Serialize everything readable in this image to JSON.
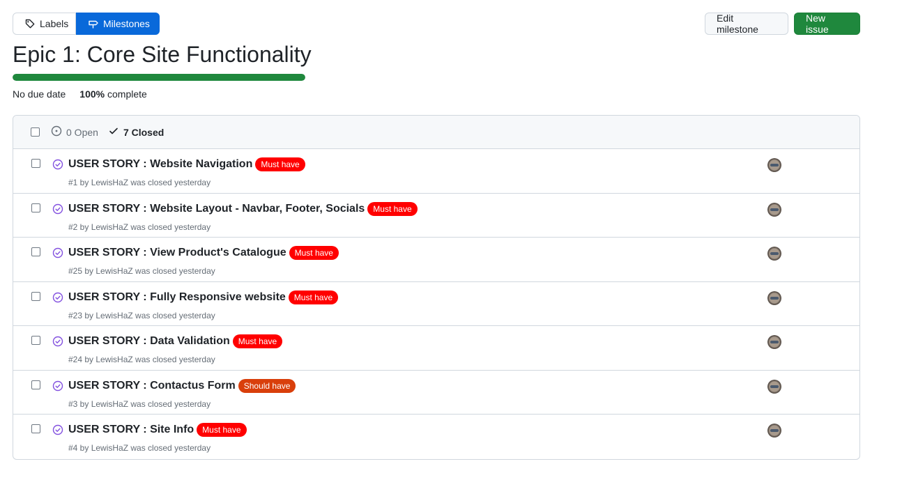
{
  "nav": {
    "labels_label": "Labels",
    "milestones_label": "Milestones"
  },
  "actions": {
    "edit_label": "Edit milestone",
    "new_label": "New issue"
  },
  "milestone": {
    "title": "Epic 1: Core Site Functionality",
    "due": "No due date",
    "percent": "100%",
    "complete_word": "complete",
    "progress_fraction": 1.0
  },
  "list": {
    "open_label": "0 Open",
    "closed_label": "7 Closed"
  },
  "colors": {
    "must_have": "#ff0000",
    "should_have": "#d93f0b",
    "closed_icon": "#8250df",
    "progress": "#1f883d"
  },
  "issues": [
    {
      "title": "USER STORY : Website Navigation",
      "label": "Must have",
      "label_color": "#ff0000",
      "meta": "#1 by LewisHaZ was closed yesterday"
    },
    {
      "title": "USER STORY : Website Layout - Navbar, Footer, Socials",
      "label": "Must have",
      "label_color": "#ff0000",
      "meta": "#2 by LewisHaZ was closed yesterday"
    },
    {
      "title": "USER STORY : View Product's Catalogue",
      "label": "Must have",
      "label_color": "#ff0000",
      "meta": "#25 by LewisHaZ was closed yesterday"
    },
    {
      "title": "USER STORY : Fully Responsive website",
      "label": "Must have",
      "label_color": "#ff0000",
      "meta": "#23 by LewisHaZ was closed yesterday"
    },
    {
      "title": "USER STORY : Data Validation",
      "label": "Must have",
      "label_color": "#ff0000",
      "meta": "#24 by LewisHaZ was closed yesterday"
    },
    {
      "title": "USER STORY : Contactus Form",
      "label": "Should have",
      "label_color": "#d93f0b",
      "meta": "#3 by LewisHaZ was closed yesterday"
    },
    {
      "title": "USER STORY : Site Info",
      "label": "Must have",
      "label_color": "#ff0000",
      "meta": "#4 by LewisHaZ was closed yesterday"
    }
  ]
}
